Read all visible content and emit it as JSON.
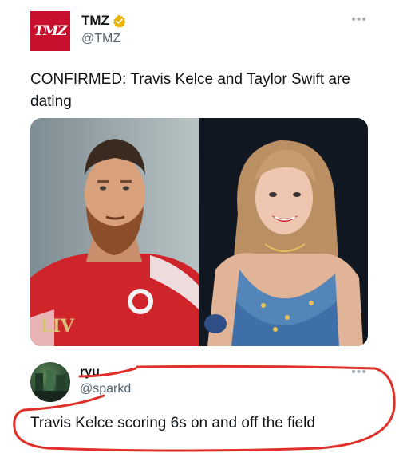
{
  "tweet": {
    "display_name": "TMZ",
    "handle": "@TMZ",
    "avatar_text": "TMZ",
    "text": "CONFIRMED: Travis Kelce and Taylor Swift are dating",
    "more_icon": "more-horizontal-icon",
    "verified_icon": "verified-badge-icon",
    "media": [
      "photo-travis-kelce",
      "photo-taylor-swift"
    ],
    "brand_color": "#c8102e",
    "verified_color": "#e8b400"
  },
  "reply": {
    "display_name": "ryu",
    "handle": "@sparkd",
    "text": "Travis Kelce scoring 6s on and off the field",
    "more_icon": "more-horizontal-icon",
    "annotation_color": "#e0302a"
  }
}
